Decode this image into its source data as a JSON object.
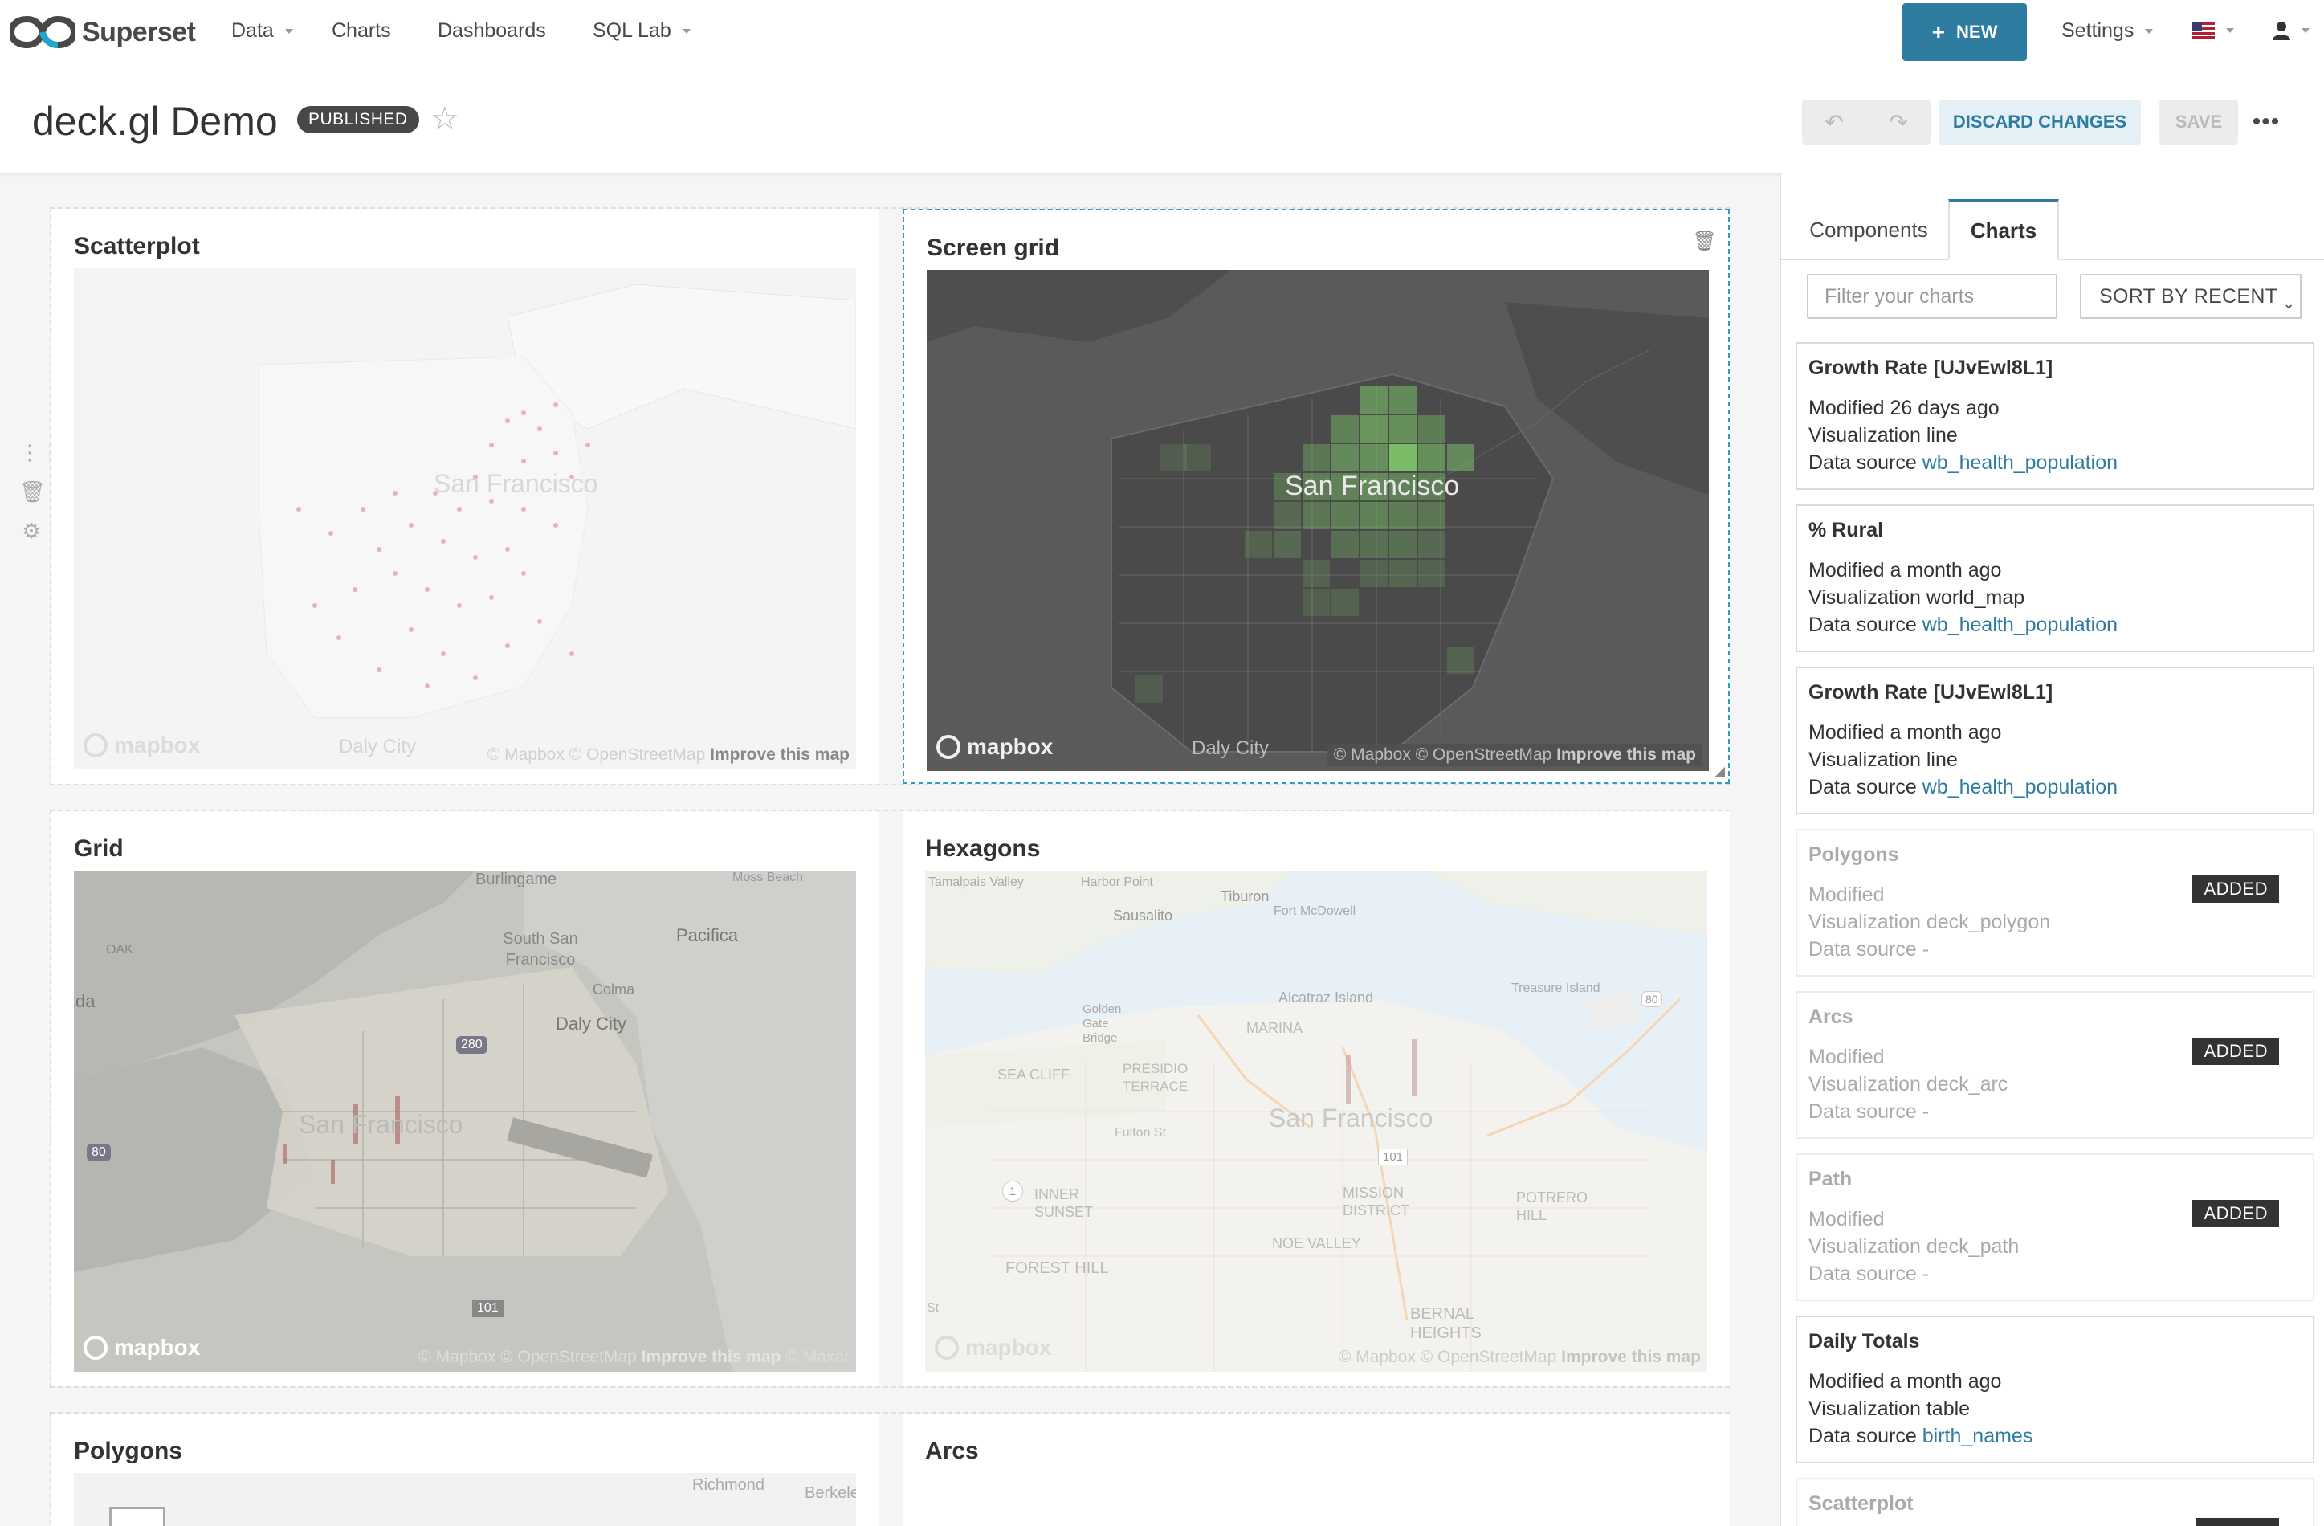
{
  "nav": {
    "brand": "Superset",
    "items": [
      {
        "label": "Data",
        "has_caret": true
      },
      {
        "label": "Charts",
        "has_caret": false
      },
      {
        "label": "Dashboards",
        "has_caret": false
      },
      {
        "label": "SQL Lab",
        "has_caret": true
      }
    ],
    "new_label": "NEW",
    "settings_label": "Settings",
    "language_flag": "us-flag-icon",
    "user_icon": "user-icon"
  },
  "header": {
    "title": "deck.gl Demo",
    "status_badge": "PUBLISHED",
    "discard_label": "DISCARD CHANGES",
    "save_label": "SAVE"
  },
  "charts": {
    "scatterplot": {
      "title": "Scatterplot",
      "city": "San Francisco",
      "daly": "Daly City",
      "attrib": "© Mapbox © OpenStreetMap",
      "improve": "Improve this map",
      "logo": "mapbox"
    },
    "screen_grid": {
      "title": "Screen grid",
      "city": "San Francisco",
      "daly": "Daly City",
      "attrib": "© Mapbox © OpenStreetMap",
      "improve": "Improve this map",
      "logo": "mapbox"
    },
    "grid": {
      "title": "Grid",
      "attrib": "© Mapbox © OpenStreetMap",
      "improve": "Improve this map",
      "maxar": "© Maxar",
      "logo": "mapbox",
      "labels": [
        "Burlingame",
        "South San Francisco",
        "Pacifica",
        "Colma",
        "Daly City",
        "San Francisco",
        "Moss Beach",
        "OAK",
        "da",
        "101",
        "80",
        "280"
      ]
    },
    "hexagons": {
      "title": "Hexagons",
      "city": "San Francisco",
      "attrib": "© Mapbox © OpenStreetMap",
      "improve": "Improve this map",
      "logo": "mapbox",
      "labels": [
        "Tamalpais Valley",
        "Harbor Point",
        "Tiburon",
        "Sausalito",
        "Fort McDowell",
        "Alcatraz Island",
        "Treasure Island",
        "Golden Gate Bridge",
        "MARINA",
        "SEA CLIFF",
        "PRESIDIO TERRACE",
        "INNER SUNSET",
        "FOREST HILL",
        "BERNAL HEIGHTS",
        "POTRERO HILL",
        "NOE VALLEY",
        "MISSION DISTRICT",
        "Fulton St",
        "101",
        "80",
        "1",
        "St"
      ]
    },
    "polygons": {
      "title": "Polygons",
      "labels": [
        "Richmond",
        "Berkeley"
      ]
    },
    "arcs": {
      "title": "Arcs"
    }
  },
  "sidepanel": {
    "tabs": [
      "Components",
      "Charts"
    ],
    "active_tab": "Charts",
    "filter_placeholder": "Filter your charts",
    "sort_label": "SORT BY RECENT",
    "labels": {
      "modified": "Modified",
      "visualization": "Visualization",
      "datasource": "Data source"
    },
    "added_label": "ADDED",
    "items": [
      {
        "title": "Growth Rate [UJvEwl8L1]",
        "modified": "26 days ago",
        "viz": "line",
        "datasource": "wb_health_population",
        "added": false
      },
      {
        "title": "% Rural",
        "modified": "a month ago",
        "viz": "world_map",
        "datasource": "wb_health_population",
        "added": false
      },
      {
        "title": "Growth Rate [UJvEwl8L1]",
        "modified": "a month ago",
        "viz": "line",
        "datasource": "wb_health_population",
        "added": false
      },
      {
        "title": "Polygons",
        "modified": "",
        "viz": "deck_polygon",
        "datasource": "-",
        "added": true
      },
      {
        "title": "Arcs",
        "modified": "",
        "viz": "deck_arc",
        "datasource": "-",
        "added": true
      },
      {
        "title": "Path",
        "modified": "",
        "viz": "deck_path",
        "datasource": "-",
        "added": true
      },
      {
        "title": "Daily Totals",
        "modified": "a month ago",
        "viz": "table",
        "datasource": "birth_names",
        "added": false
      },
      {
        "title": "Scatterplot",
        "modified": "",
        "viz": "",
        "datasource": "",
        "added": true
      }
    ]
  },
  "colors": {
    "accent": "#2e7ca0",
    "badge_bg": "#484848",
    "screen_grid_bg": "#555555",
    "grid_green": "#7ec86a"
  }
}
